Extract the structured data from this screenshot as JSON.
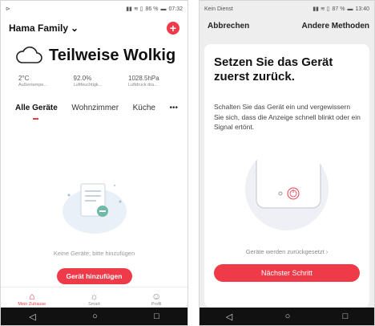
{
  "left": {
    "status": {
      "left": "⊳",
      "battery": "86 %",
      "time": "07:32"
    },
    "family": "Hama Family",
    "weather": {
      "condition": "Teilweise Wolkig",
      "metrics": [
        {
          "value": "2°C",
          "label": "Außentempe..."
        },
        {
          "value": "92.0%",
          "label": "Luftfeuchtigk..."
        },
        {
          "value": "1028.5hPa",
          "label": "Luftdruck dra..."
        }
      ]
    },
    "tabs": [
      "Alle Geräte",
      "Wohnzimmer",
      "Küche"
    ],
    "more": "•••",
    "empty_text": "Keine Geräte; bitte hinzufügen",
    "add_button": "Gerät hinzufügen",
    "nav": [
      {
        "label": "Mein Zuhause",
        "icon": "home-icon"
      },
      {
        "label": "Smart",
        "icon": "sun-icon"
      },
      {
        "label": "Profil",
        "icon": "profile-icon"
      }
    ]
  },
  "right": {
    "status": {
      "left": "Kein Dienst",
      "battery": "87 %",
      "time": "13:40"
    },
    "cancel": "Abbrechen",
    "other_methods": "Andere Methoden",
    "title": "Setzen Sie das Gerät zuerst zurück.",
    "desc": "Schalten Sie das Gerät ein und vergewissern Sie sich, dass die Anzeige schnell blinkt oder ein Signal ertönt.",
    "reset_link": "Geräte werden zurückgesetzt",
    "next": "Nächster Schritt"
  },
  "colors": {
    "accent": "#ef3b49"
  }
}
